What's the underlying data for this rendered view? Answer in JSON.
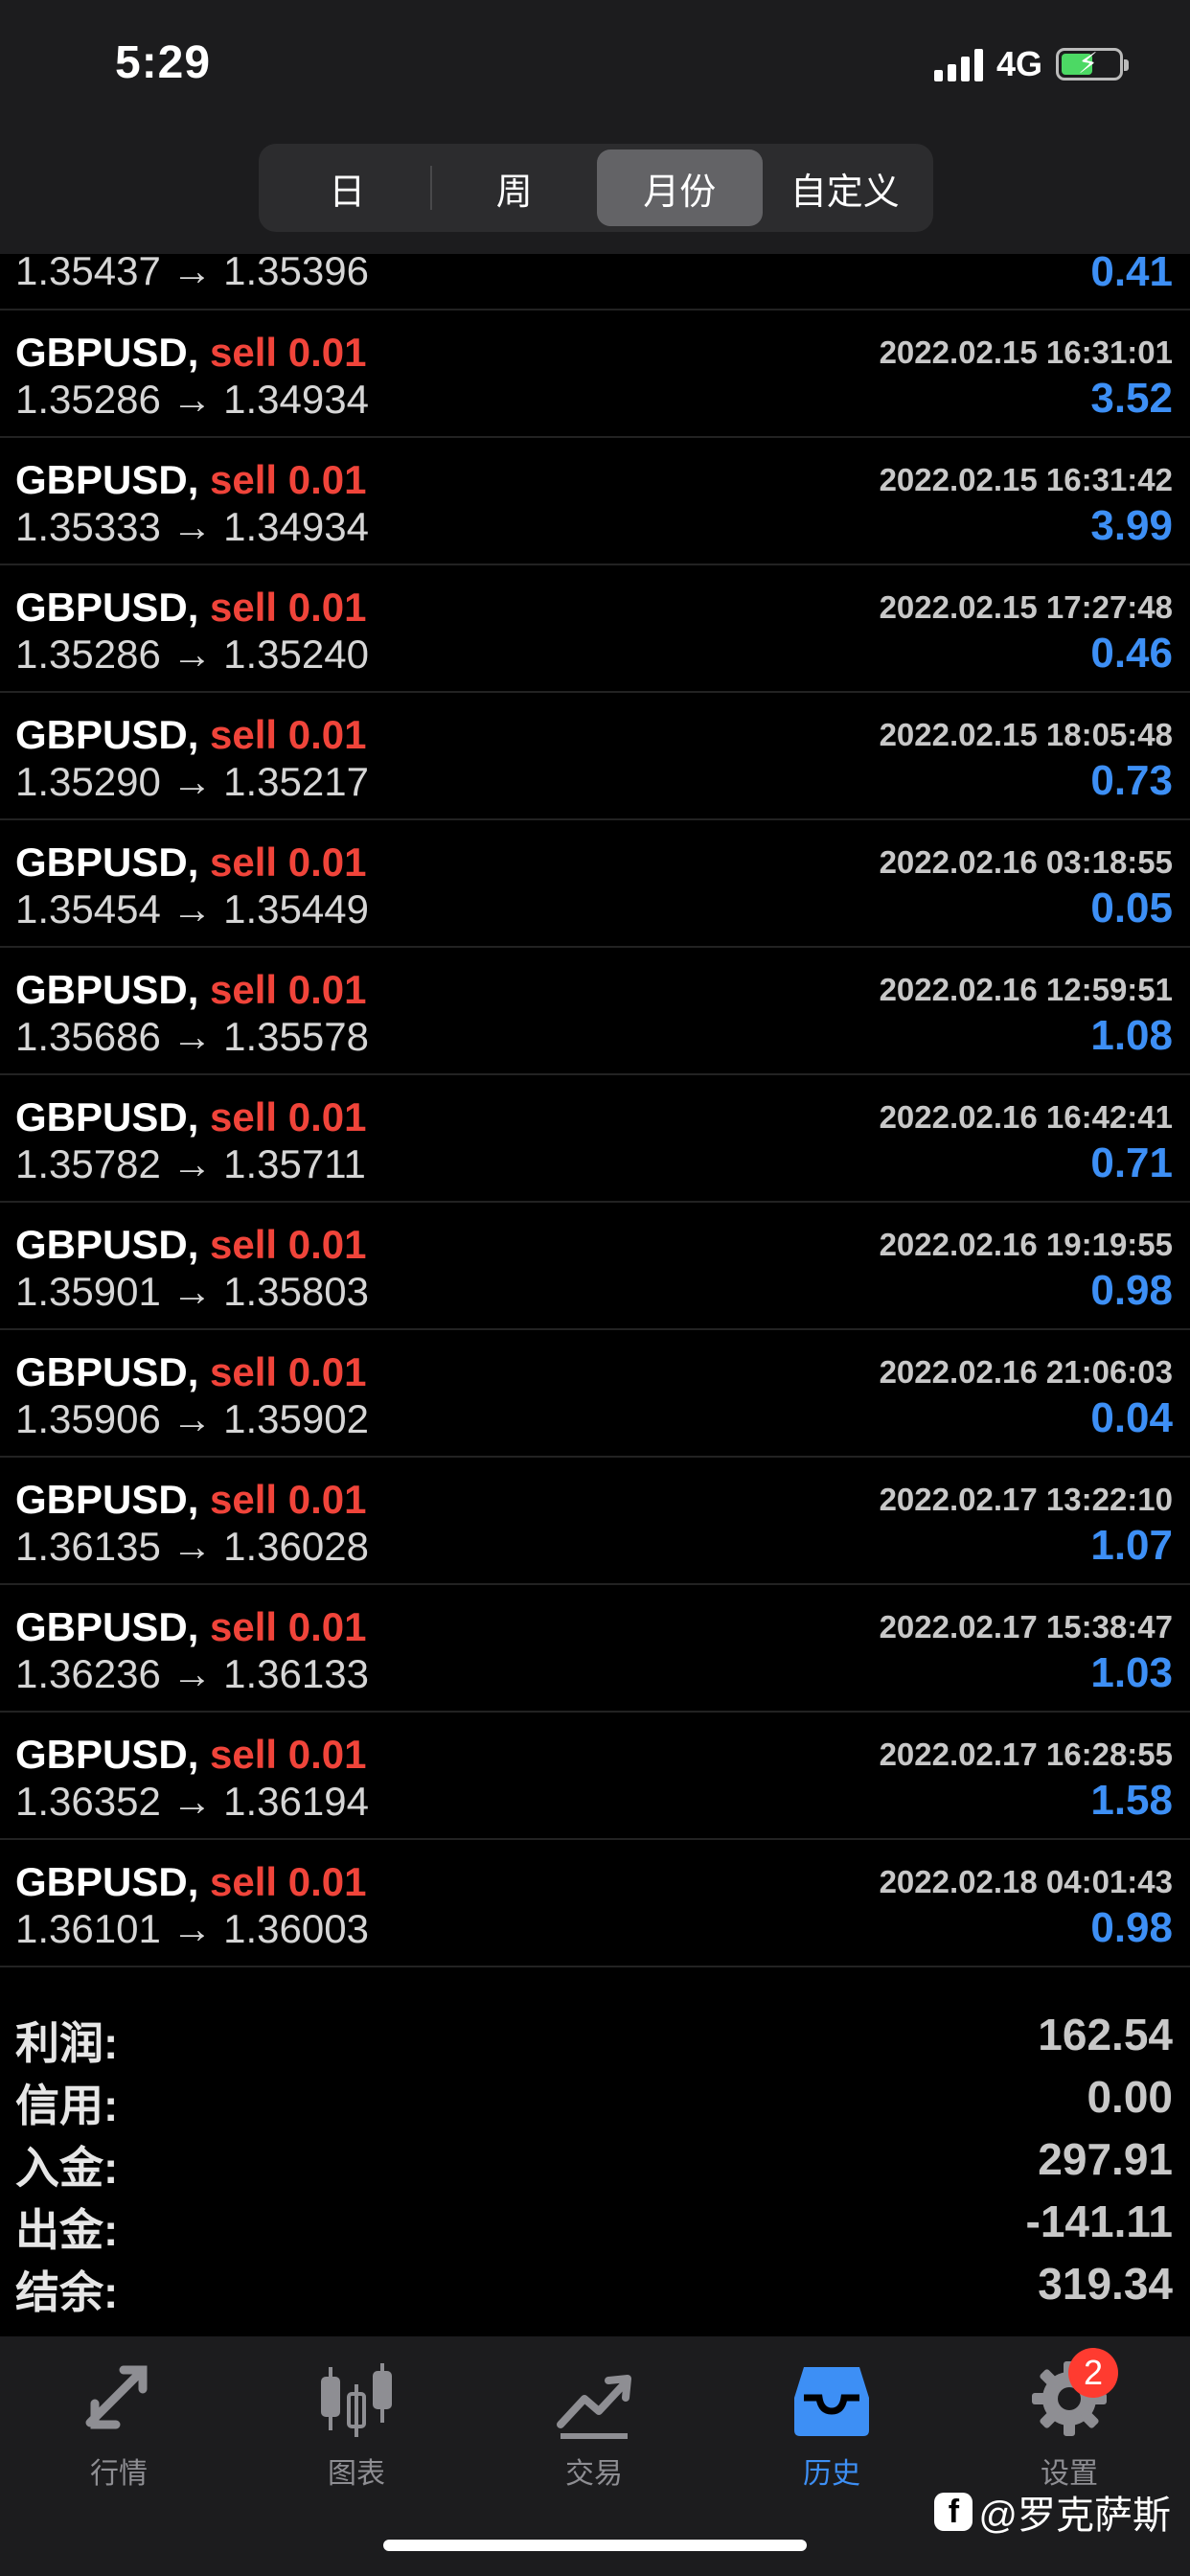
{
  "status": {
    "time": "5:29",
    "network": "4G"
  },
  "segments": [
    {
      "label": "日",
      "active": false
    },
    {
      "label": "周",
      "active": false
    },
    {
      "label": "月份",
      "active": true
    },
    {
      "label": "自定义",
      "active": false
    }
  ],
  "partial_row": {
    "prices": "1.35437 → 1.35396",
    "profit": "0.41"
  },
  "trades": [
    {
      "symbol": "GBPUSD,",
      "side": "sell 0.01",
      "time": "2022.02.15 16:31:01",
      "prices": "1.35286 → 1.34934",
      "profit": "3.52"
    },
    {
      "symbol": "GBPUSD,",
      "side": "sell 0.01",
      "time": "2022.02.15 16:31:42",
      "prices": "1.35333 → 1.34934",
      "profit": "3.99"
    },
    {
      "symbol": "GBPUSD,",
      "side": "sell 0.01",
      "time": "2022.02.15 17:27:48",
      "prices": "1.35286 → 1.35240",
      "profit": "0.46"
    },
    {
      "symbol": "GBPUSD,",
      "side": "sell 0.01",
      "time": "2022.02.15 18:05:48",
      "prices": "1.35290 → 1.35217",
      "profit": "0.73"
    },
    {
      "symbol": "GBPUSD,",
      "side": "sell 0.01",
      "time": "2022.02.16 03:18:55",
      "prices": "1.35454 → 1.35449",
      "profit": "0.05"
    },
    {
      "symbol": "GBPUSD,",
      "side": "sell 0.01",
      "time": "2022.02.16 12:59:51",
      "prices": "1.35686 → 1.35578",
      "profit": "1.08"
    },
    {
      "symbol": "GBPUSD,",
      "side": "sell 0.01",
      "time": "2022.02.16 16:42:41",
      "prices": "1.35782 → 1.35711",
      "profit": "0.71"
    },
    {
      "symbol": "GBPUSD,",
      "side": "sell 0.01",
      "time": "2022.02.16 19:19:55",
      "prices": "1.35901 → 1.35803",
      "profit": "0.98"
    },
    {
      "symbol": "GBPUSD,",
      "side": "sell 0.01",
      "time": "2022.02.16 21:06:03",
      "prices": "1.35906 → 1.35902",
      "profit": "0.04"
    },
    {
      "symbol": "GBPUSD,",
      "side": "sell 0.01",
      "time": "2022.02.17 13:22:10",
      "prices": "1.36135 → 1.36028",
      "profit": "1.07"
    },
    {
      "symbol": "GBPUSD,",
      "side": "sell 0.01",
      "time": "2022.02.17 15:38:47",
      "prices": "1.36236 → 1.36133",
      "profit": "1.03"
    },
    {
      "symbol": "GBPUSD,",
      "side": "sell 0.01",
      "time": "2022.02.17 16:28:55",
      "prices": "1.36352 → 1.36194",
      "profit": "1.58"
    },
    {
      "symbol": "GBPUSD,",
      "side": "sell 0.01",
      "time": "2022.02.18 04:01:43",
      "prices": "1.36101 → 1.36003",
      "profit": "0.98"
    }
  ],
  "summary": [
    {
      "label": "利润:",
      "value": "162.54"
    },
    {
      "label": "信用:",
      "value": "0.00"
    },
    {
      "label": "入金:",
      "value": "297.91"
    },
    {
      "label": "出金:",
      "value": "-141.11"
    },
    {
      "label": "结余:",
      "value": "319.34"
    }
  ],
  "tabs": [
    {
      "label": "行情",
      "icon": "quotes-arrows-icon",
      "active": false
    },
    {
      "label": "图表",
      "icon": "candlestick-icon",
      "active": false
    },
    {
      "label": "交易",
      "icon": "trade-chart-icon",
      "active": false
    },
    {
      "label": "历史",
      "icon": "history-inbox-icon",
      "active": true
    },
    {
      "label": "设置",
      "icon": "gear-icon",
      "active": false,
      "badge": "2"
    }
  ],
  "watermark": {
    "text": "@罗克萨斯",
    "logo": "f"
  },
  "colors": {
    "sell": "#f0443a",
    "profit": "#3d8ff5",
    "active_tab": "#3d8ff5",
    "badge": "#ff3b30"
  }
}
